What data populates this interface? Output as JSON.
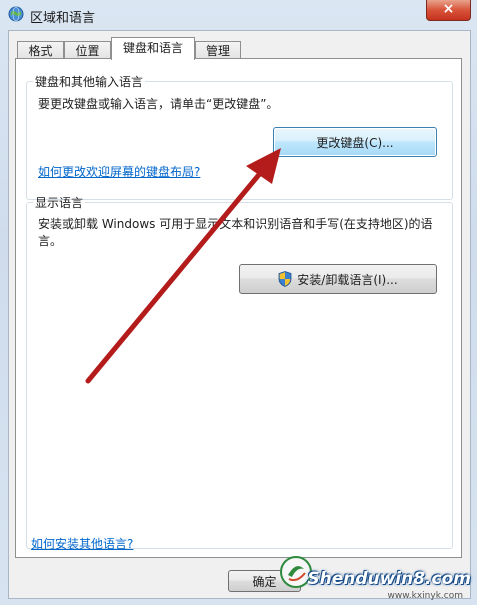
{
  "window": {
    "title": "区域和语言",
    "close_symbol": "×"
  },
  "tabs": [
    {
      "label": "格式"
    },
    {
      "label": "位置"
    },
    {
      "label": "键盘和语言",
      "active": true
    },
    {
      "label": "管理"
    }
  ],
  "keyboard_group": {
    "legend": "键盘和其他输入语言",
    "description": "要更改键盘或输入语言，请单击“更改键盘”。",
    "change_button": "更改键盘(C)...",
    "help_link": "如何更改欢迎屏幕的键盘布局?"
  },
  "display_group": {
    "legend": "显示语言",
    "description": "安装或卸载 Windows 可用于显示文本和识别语音和手写(在支持地区)的语言。",
    "install_button": "安装/卸载语言(I)..."
  },
  "footer_link": "如何安装其他语言?",
  "ok_button": "确定",
  "watermark": {
    "brand": "Shenduwin8.com",
    "url": "www.kxinyk.com"
  },
  "colors": {
    "annotation_arrow": "#b41c1c",
    "link": "#0066cc",
    "accent": "#3c7fb1"
  },
  "icons": {
    "app": "globe-icon",
    "shield": "uac-shield-icon"
  }
}
